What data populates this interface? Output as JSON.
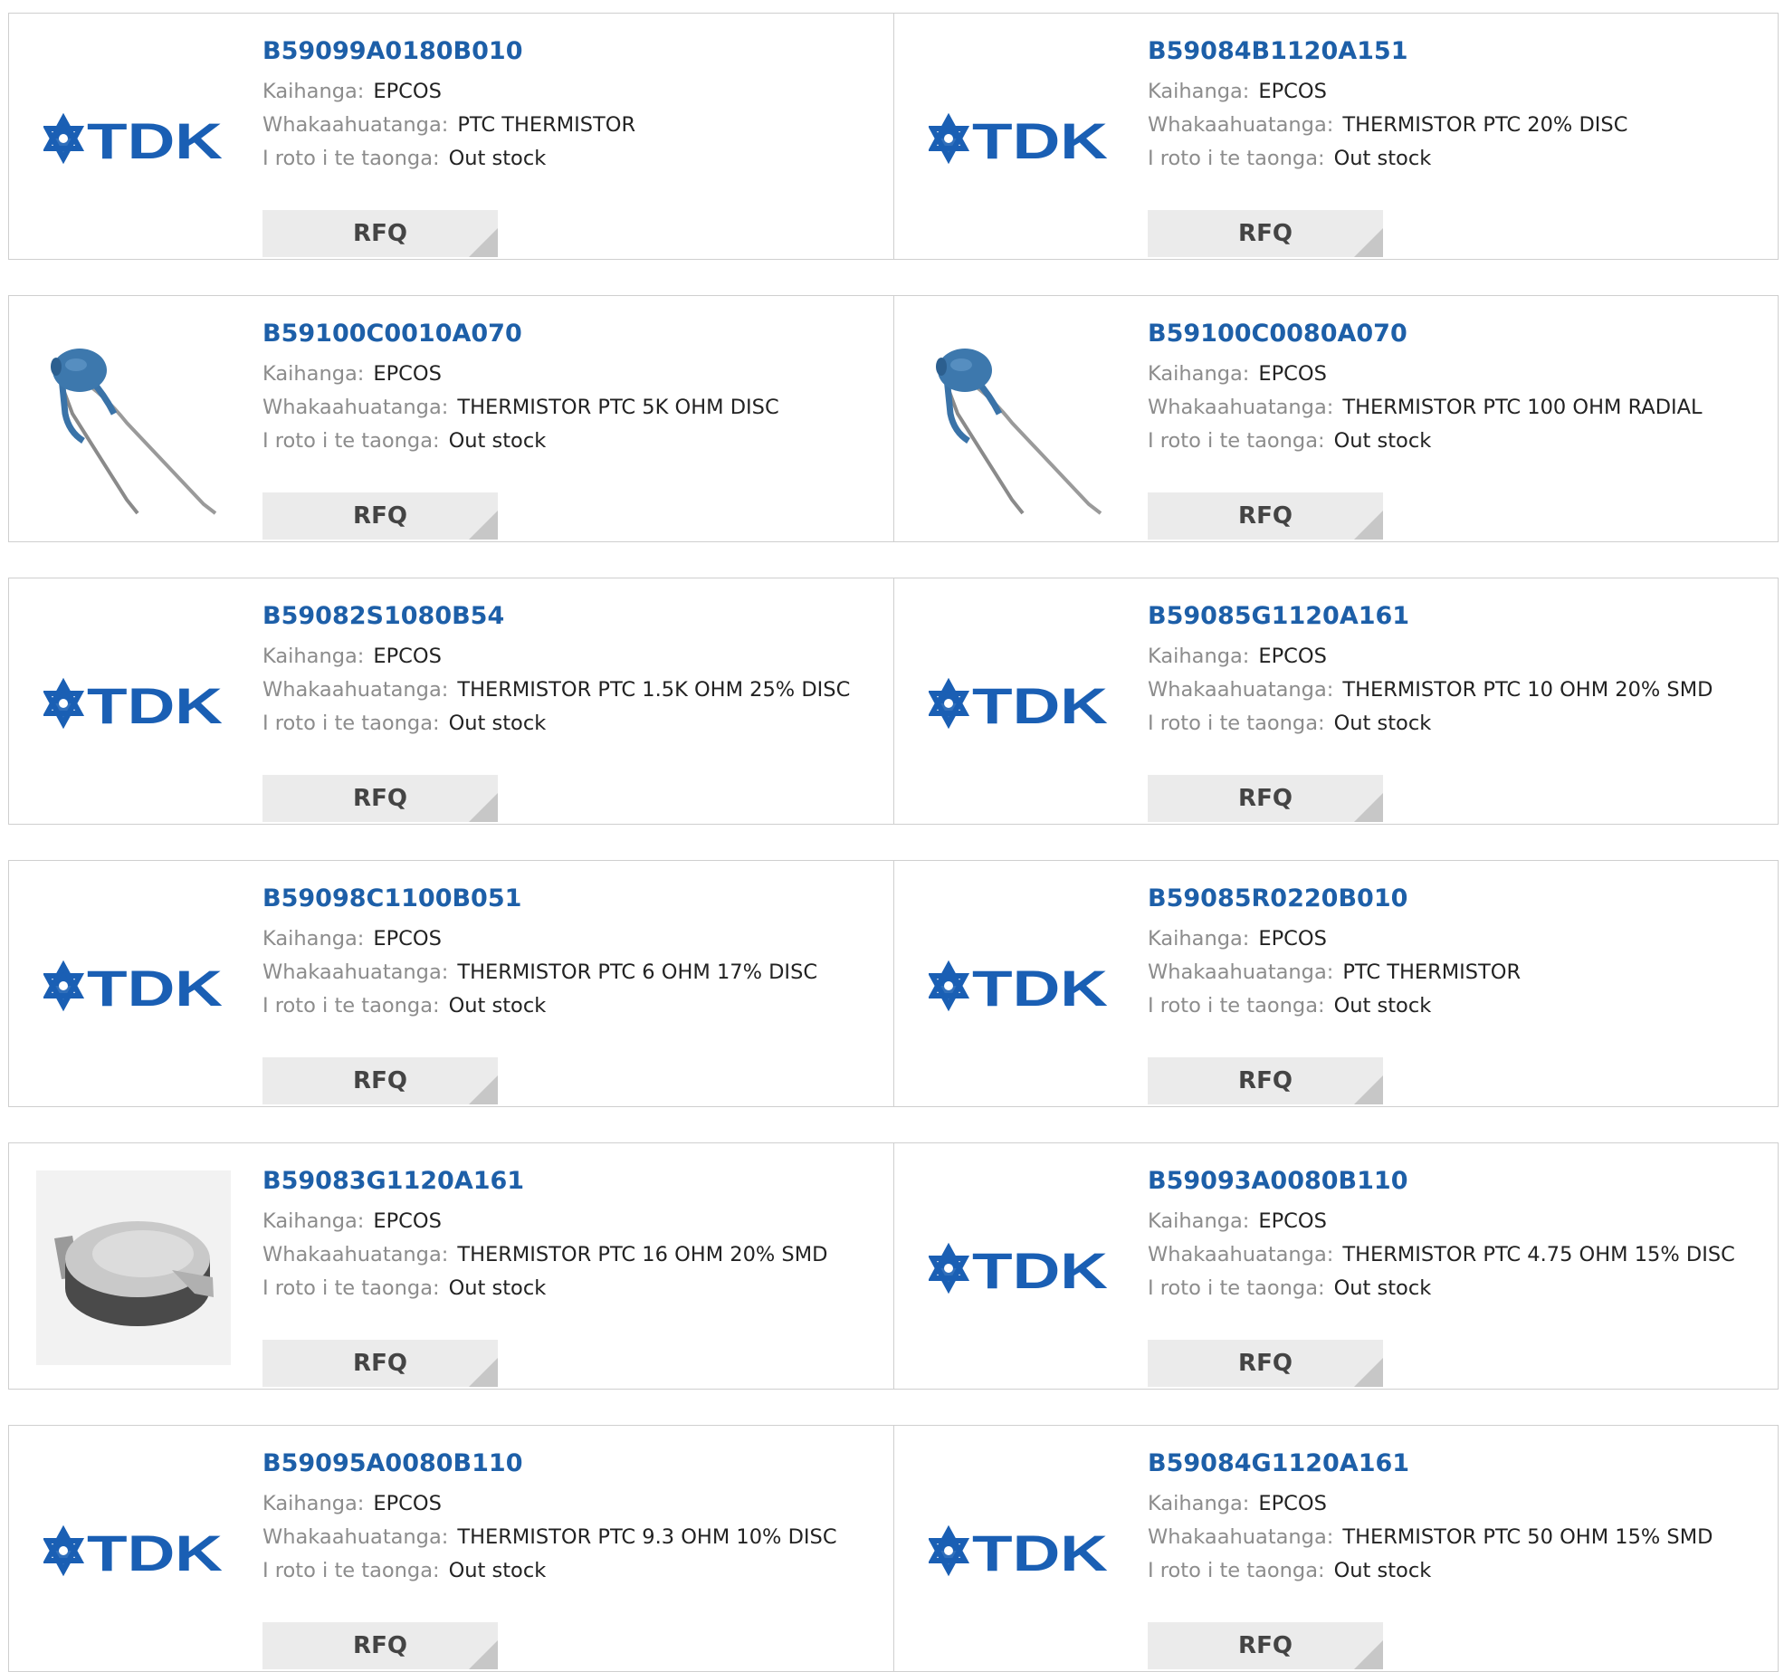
{
  "labels": {
    "manufacturer": "Kaihanga:",
    "description": "Whakaahuatanga:",
    "stock": "I roto i te taonga:",
    "rfq": "RFQ"
  },
  "rows": [
    [
      {
        "part": "B59099A0180B010",
        "manufacturer": "EPCOS",
        "description": "PTC THERMISTOR",
        "stock": "Out stock",
        "image": "tdk-logo"
      },
      {
        "part": "B59084B1120A151",
        "manufacturer": "EPCOS",
        "description": "THERMISTOR PTC 20% DISC",
        "stock": "Out stock",
        "image": "tdk-logo"
      }
    ],
    [
      {
        "part": "B59100C0010A070",
        "manufacturer": "EPCOS",
        "description": "THERMISTOR PTC 5K OHM DISC",
        "stock": "Out stock",
        "image": "radial-thermistor"
      },
      {
        "part": "B59100C0080A070",
        "manufacturer": "EPCOS",
        "description": "THERMISTOR PTC 100 OHM RADIAL",
        "stock": "Out stock",
        "image": "radial-thermistor"
      }
    ],
    [
      {
        "part": "B59082S1080B54",
        "manufacturer": "EPCOS",
        "description": "THERMISTOR PTC 1.5K OHM 25% DISC",
        "stock": "Out stock",
        "image": "tdk-logo"
      },
      {
        "part": "B59085G1120A161",
        "manufacturer": "EPCOS",
        "description": "THERMISTOR PTC 10 OHM 20% SMD",
        "stock": "Out stock",
        "image": "tdk-logo"
      }
    ],
    [
      {
        "part": "B59098C1100B051",
        "manufacturer": "EPCOS",
        "description": "THERMISTOR PTC 6 OHM 17% DISC",
        "stock": "Out stock",
        "image": "tdk-logo"
      },
      {
        "part": "B59085R0220B010",
        "manufacturer": "EPCOS",
        "description": "PTC THERMISTOR",
        "stock": "Out stock",
        "image": "tdk-logo"
      }
    ],
    [
      {
        "part": "B59083G1120A161",
        "manufacturer": "EPCOS",
        "description": "THERMISTOR PTC 16 OHM 20% SMD",
        "stock": "Out stock",
        "image": "smd-thermistor"
      },
      {
        "part": "B59093A0080B110",
        "manufacturer": "EPCOS",
        "description": "THERMISTOR PTC 4.75 OHM 15% DISC",
        "stock": "Out stock",
        "image": "tdk-logo"
      }
    ],
    [
      {
        "part": "B59095A0080B110",
        "manufacturer": "EPCOS",
        "description": "THERMISTOR PTC 9.3 OHM 10% DISC",
        "stock": "Out stock",
        "image": "tdk-logo"
      },
      {
        "part": "B59084G1120A161",
        "manufacturer": "EPCOS",
        "description": "THERMISTOR PTC 50 OHM 15% SMD",
        "stock": "Out stock",
        "image": "tdk-logo"
      }
    ]
  ],
  "logo": {
    "text": "TDK"
  },
  "colors": {
    "link": "#1d5fa8",
    "logo": "#1a5fb4",
    "label": "#8c8c8c",
    "border": "#cfcfcf",
    "button_bg": "#ebebeb"
  }
}
